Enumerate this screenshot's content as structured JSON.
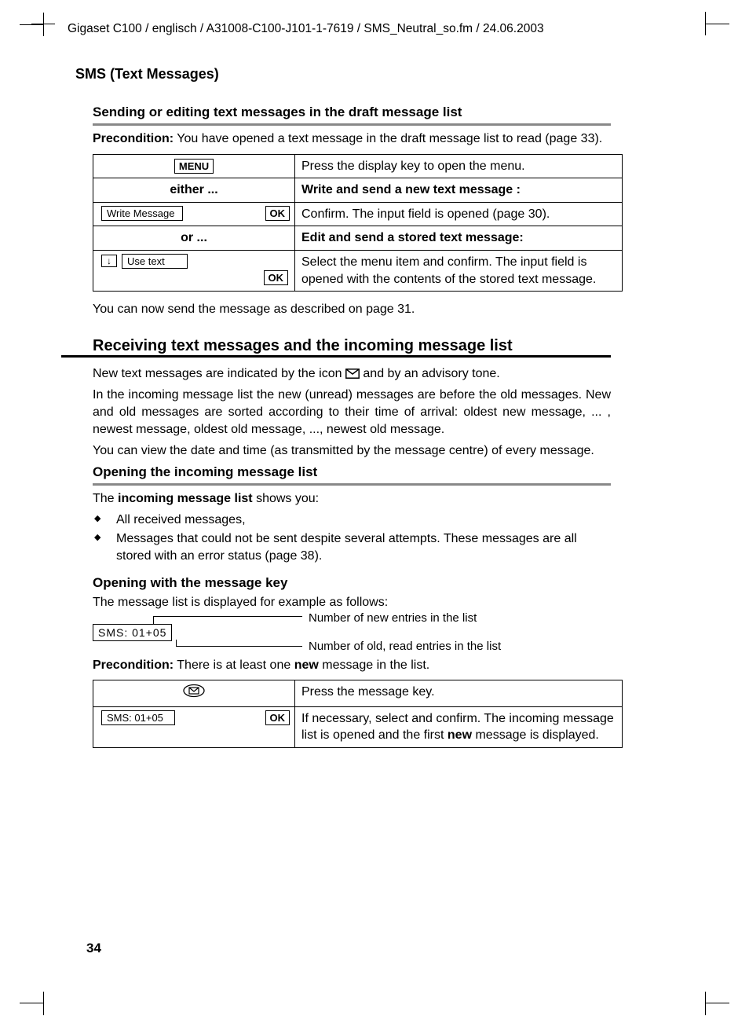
{
  "header_path": "Gigaset C100 / englisch / A31008-C100-J101-1-7619 / SMS_Neutral_so.fm / 24.06.2003",
  "section_header": "SMS (Text Messages)",
  "h3_1": "Sending or editing text messages in the draft message list",
  "pre1_label": "Precondition:",
  "pre1_text": " You have opened a text message in the draft message list to read (page 33).",
  "table1": {
    "menu_key": "MENU",
    "menu_desc": "Press the display key to open the menu.",
    "either_label": "either ...",
    "either_desc": "Write and send a new text message :",
    "write_item": "Write Message",
    "ok": "OK",
    "write_desc": "Confirm. The input field is opened (page 30).",
    "or_label": "or ...",
    "or_desc": "Edit and send a stored text message:",
    "use_item": "Use text",
    "use_desc": "Select the menu item and confirm. The input field is opened with the contents of the stored text message."
  },
  "after_table1": "You can now send the message as described on page 31.",
  "h2": "Receiving text messages and the incoming message list",
  "p_new_pre": "New text messages are indicated by the icon ",
  "p_new_post": " and by an advisory tone.",
  "p_incoming": "In the incoming message list the new (unread) messages are before the old messages. New and old messages are sorted according to their time of arrival: oldest new message, ... , newest message, oldest old message, ..., newest old message.",
  "p_view": "You can view the date and time (as transmitted by the message centre) of every message.",
  "h3_2": "Opening the incoming message list",
  "p_list_intro_pre": "The ",
  "p_list_intro_bold": "incoming message list",
  "p_list_intro_post": " shows you:",
  "bullets": {
    "b1": "All received messages,",
    "b2": "Messages that could not be sent despite several attempts. These messages are all stored with an error status (page 38)."
  },
  "h4_1": "Opening with the message key",
  "p_example": "The message list is displayed for example as follows:",
  "diagram": {
    "box": "SMS:  01+05",
    "label_new": "Number of new entries in the list",
    "label_old": "Number of old, read entries in the list"
  },
  "pre2_label": "Precondition:",
  "pre2_mid": " There is at least one ",
  "pre2_bold": "new",
  "pre2_end": " message in the list.",
  "table2": {
    "msgkey_desc": "Press the message key.",
    "sms_item": "SMS: 01+05",
    "ok": "OK",
    "sms_desc_pre": "If necessary, select and confirm. The incoming message list is opened and the first ",
    "sms_desc_bold": "new",
    "sms_desc_post": " message is displayed."
  },
  "page_num": "34"
}
